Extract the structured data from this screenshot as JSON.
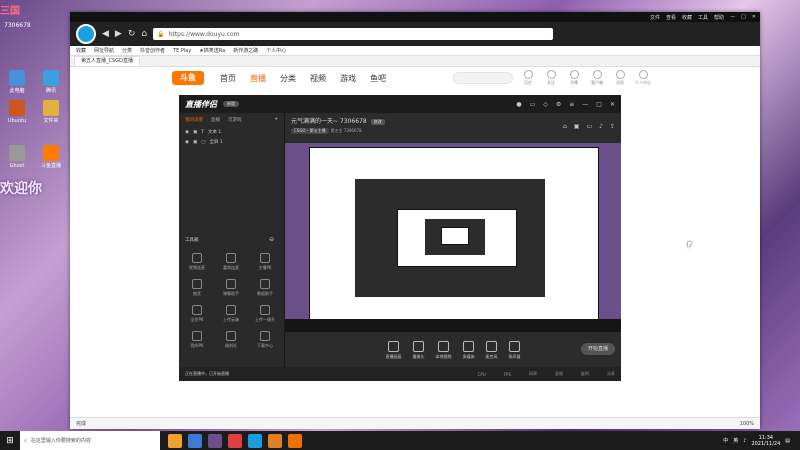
{
  "desktop": {
    "badge": "三国",
    "number": "7306678",
    "welcome": "欢迎你",
    "icons": [
      {
        "label": "此电脑",
        "color": "#4a90d9"
      },
      {
        "label": "腾讯",
        "color": "#3aa0e0"
      },
      {
        "label": "Ubuntu",
        "color": "#d0541e"
      },
      {
        "label": "文件夹",
        "color": "#e0b040"
      },
      {
        "label": "Ghost",
        "color": "#999999"
      },
      {
        "label": "斗鱼直播",
        "color": "#ff7a00"
      }
    ]
  },
  "browser": {
    "title_buttons": [
      "文件",
      "查看",
      "收藏",
      "工具",
      "帮助"
    ],
    "url": "https://www.douyu.com",
    "bookmarks": [
      "收藏",
      "网址导航",
      "分类",
      "抖音创作者",
      "TE Play",
      "★搞笑送Ra",
      "新作游之路",
      "个人中心"
    ],
    "tab_title": "第五人直播_CSGO直播",
    "status_left": "完成",
    "status_right": [
      "100%"
    ]
  },
  "douyu": {
    "logo": "斗鱼",
    "nav": [
      "首页",
      "直播",
      "分类",
      "视频",
      "游戏",
      "鱼吧"
    ],
    "active_nav": "直播",
    "header_icons": [
      "历史",
      "关注",
      "开播",
      "客户端",
      "消息",
      "个人中心"
    ]
  },
  "app": {
    "brand": "直播伴侣",
    "version": "新版",
    "room_title": "元气满满的一天~ 7306678",
    "room_tag": "修改",
    "category": "CSGO - 第五主播",
    "room_subtitle": "第五主 7306678",
    "sidebar_tabs": [
      "我的场景",
      "直播",
      "可游戏"
    ],
    "sources": [
      {
        "name": "文本 1"
      },
      {
        "name": "全屏 1"
      }
    ],
    "tools_header": "工具箱",
    "tools": [
      "视频连麦",
      "嘉宾连麦",
      "主播PK",
      "抽奖",
      "弹幕助手",
      "数据助手",
      "全民PK",
      "上传云端",
      "上传一键开",
      "我的PK",
      "福利社",
      "下载中心"
    ],
    "bottom_actions": [
      "直播画面",
      "摄像头",
      "本地视频",
      "多媒体",
      "麦克风",
      "扬声器"
    ],
    "start_button": "开始直播",
    "status_left": "正在直播中，已开始直播",
    "status_items": [
      "CPU",
      "FPS",
      "码率",
      "丢帧",
      "延时",
      "分享"
    ]
  },
  "taskbar": {
    "search_placeholder": "在这里输入你要搜索的内容",
    "apps": [
      "#f0a030",
      "#3a7bd5",
      "#6b4f8a",
      "#e04040",
      "#1a9bdb",
      "#e08020",
      "#f07000"
    ],
    "tray": [
      "中",
      "英"
    ],
    "time": "11:34",
    "date": "2021/11/24"
  }
}
